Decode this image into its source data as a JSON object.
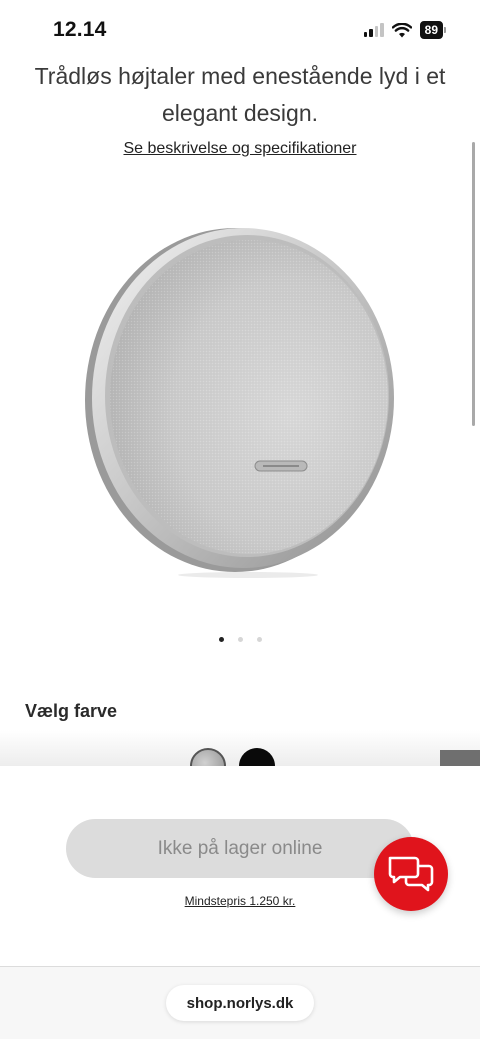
{
  "status_bar": {
    "time": "12.14",
    "battery": "89",
    "icons": [
      "cellular-signal-icon",
      "wifi-icon",
      "battery-icon"
    ]
  },
  "product": {
    "headline": "Trådløs højtaler med enestående lyd i et elegant design.",
    "spec_link": "Se beskrivelse og specifikationer",
    "image": "harman-kardon-onyx-speaker-silver",
    "carousel": {
      "total": 3,
      "active": 1
    }
  },
  "color_picker": {
    "label": "Vælg farve",
    "options": [
      {
        "name": "silver",
        "color": "#a8a8a8",
        "selected": true
      },
      {
        "name": "black",
        "color": "#0a0a0a",
        "selected": false
      }
    ]
  },
  "purchase": {
    "stock_button": "Ikke på lager online",
    "min_price": "Mindstepris 1.250 kr."
  },
  "browser": {
    "url": "shop.norlys.dk"
  },
  "colors": {
    "brand_red": "#e0141c",
    "disabled_button": "#dcdcdc",
    "disabled_text": "#8a8a8a"
  }
}
